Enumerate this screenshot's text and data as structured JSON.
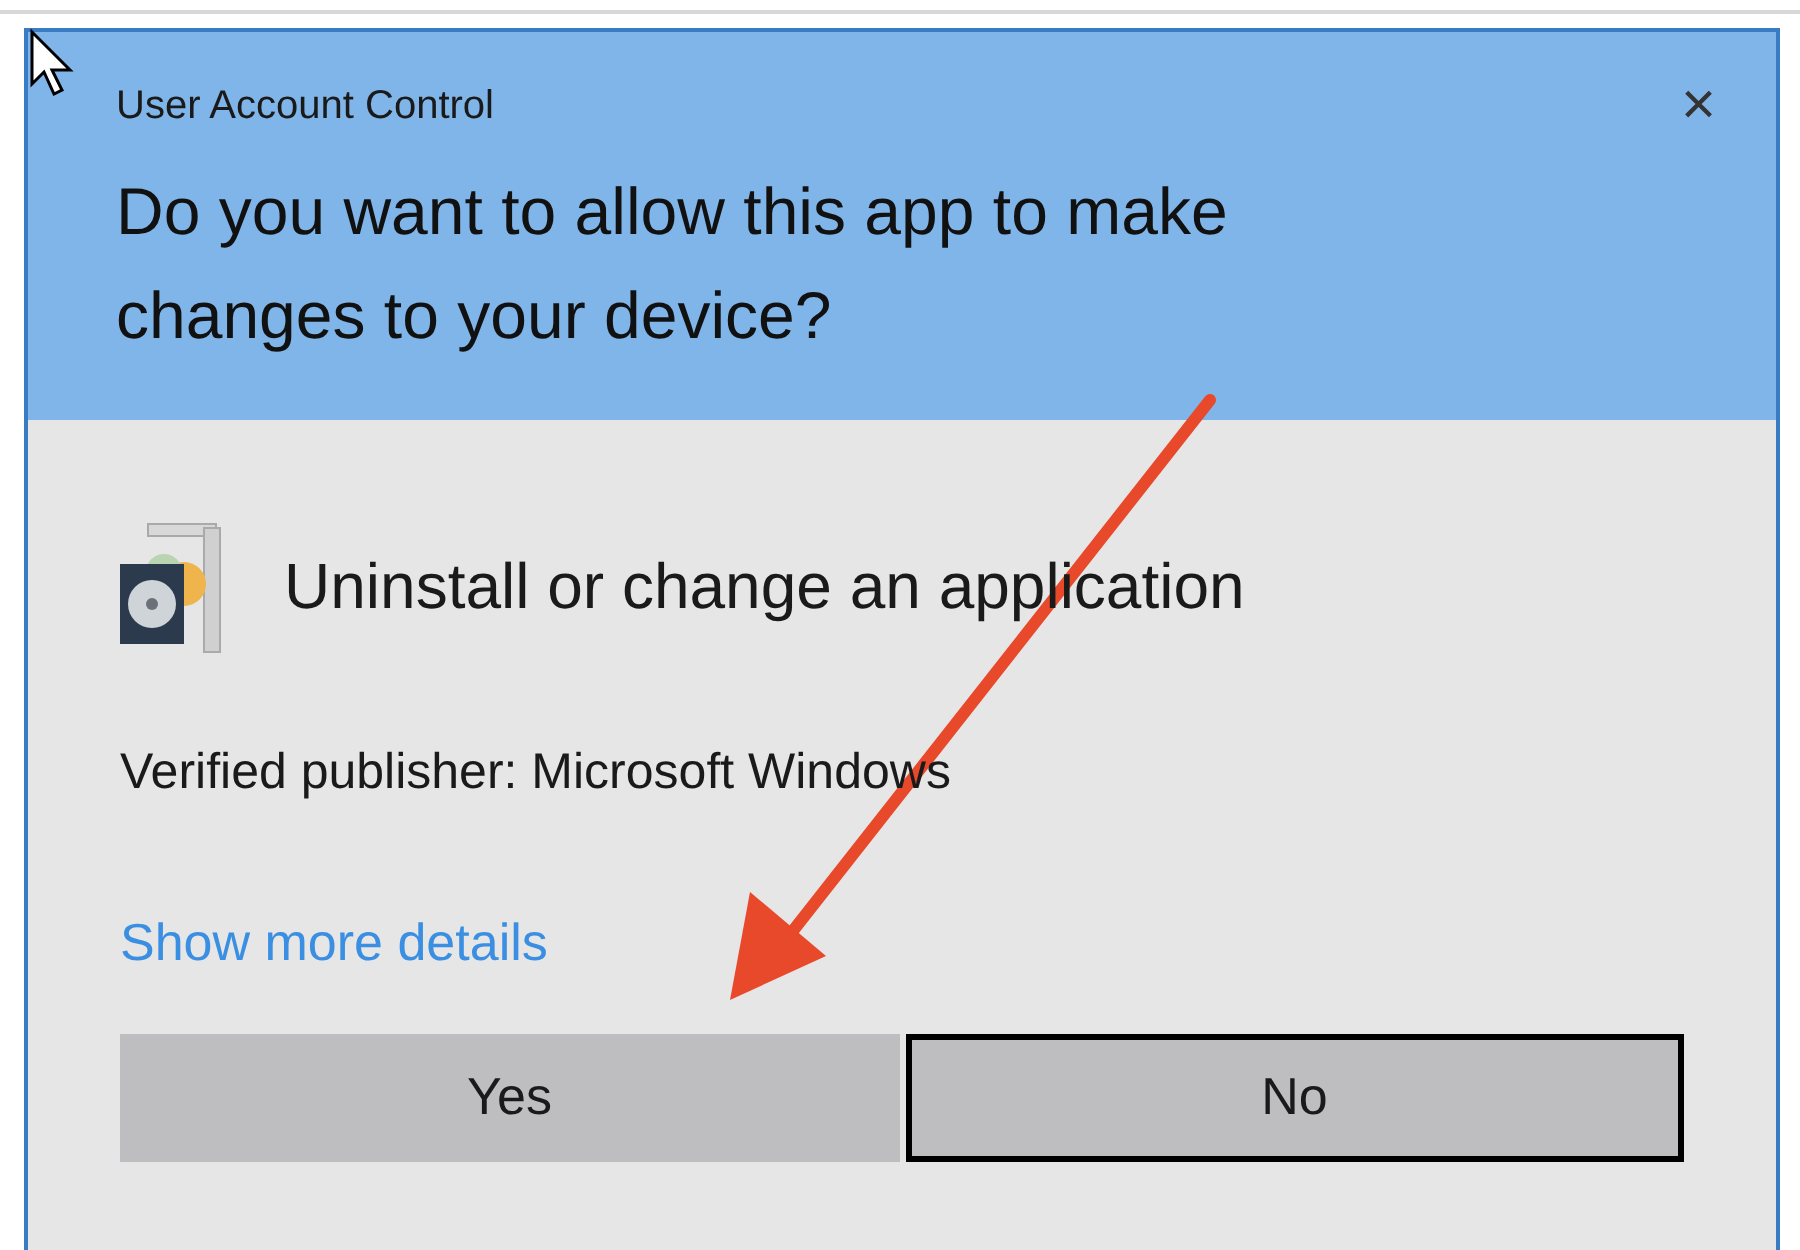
{
  "window": {
    "title": "User Account Control",
    "close": "×"
  },
  "heading": "Do you want to allow this app to make changes to your device?",
  "app_name": "Uninstall or change an application",
  "publisher": "Verified publisher: Microsoft Windows",
  "details_link": "Show more details",
  "buttons": [
    {
      "label": "Yes",
      "focused": false
    },
    {
      "label": "No",
      "focused": true
    }
  ]
}
